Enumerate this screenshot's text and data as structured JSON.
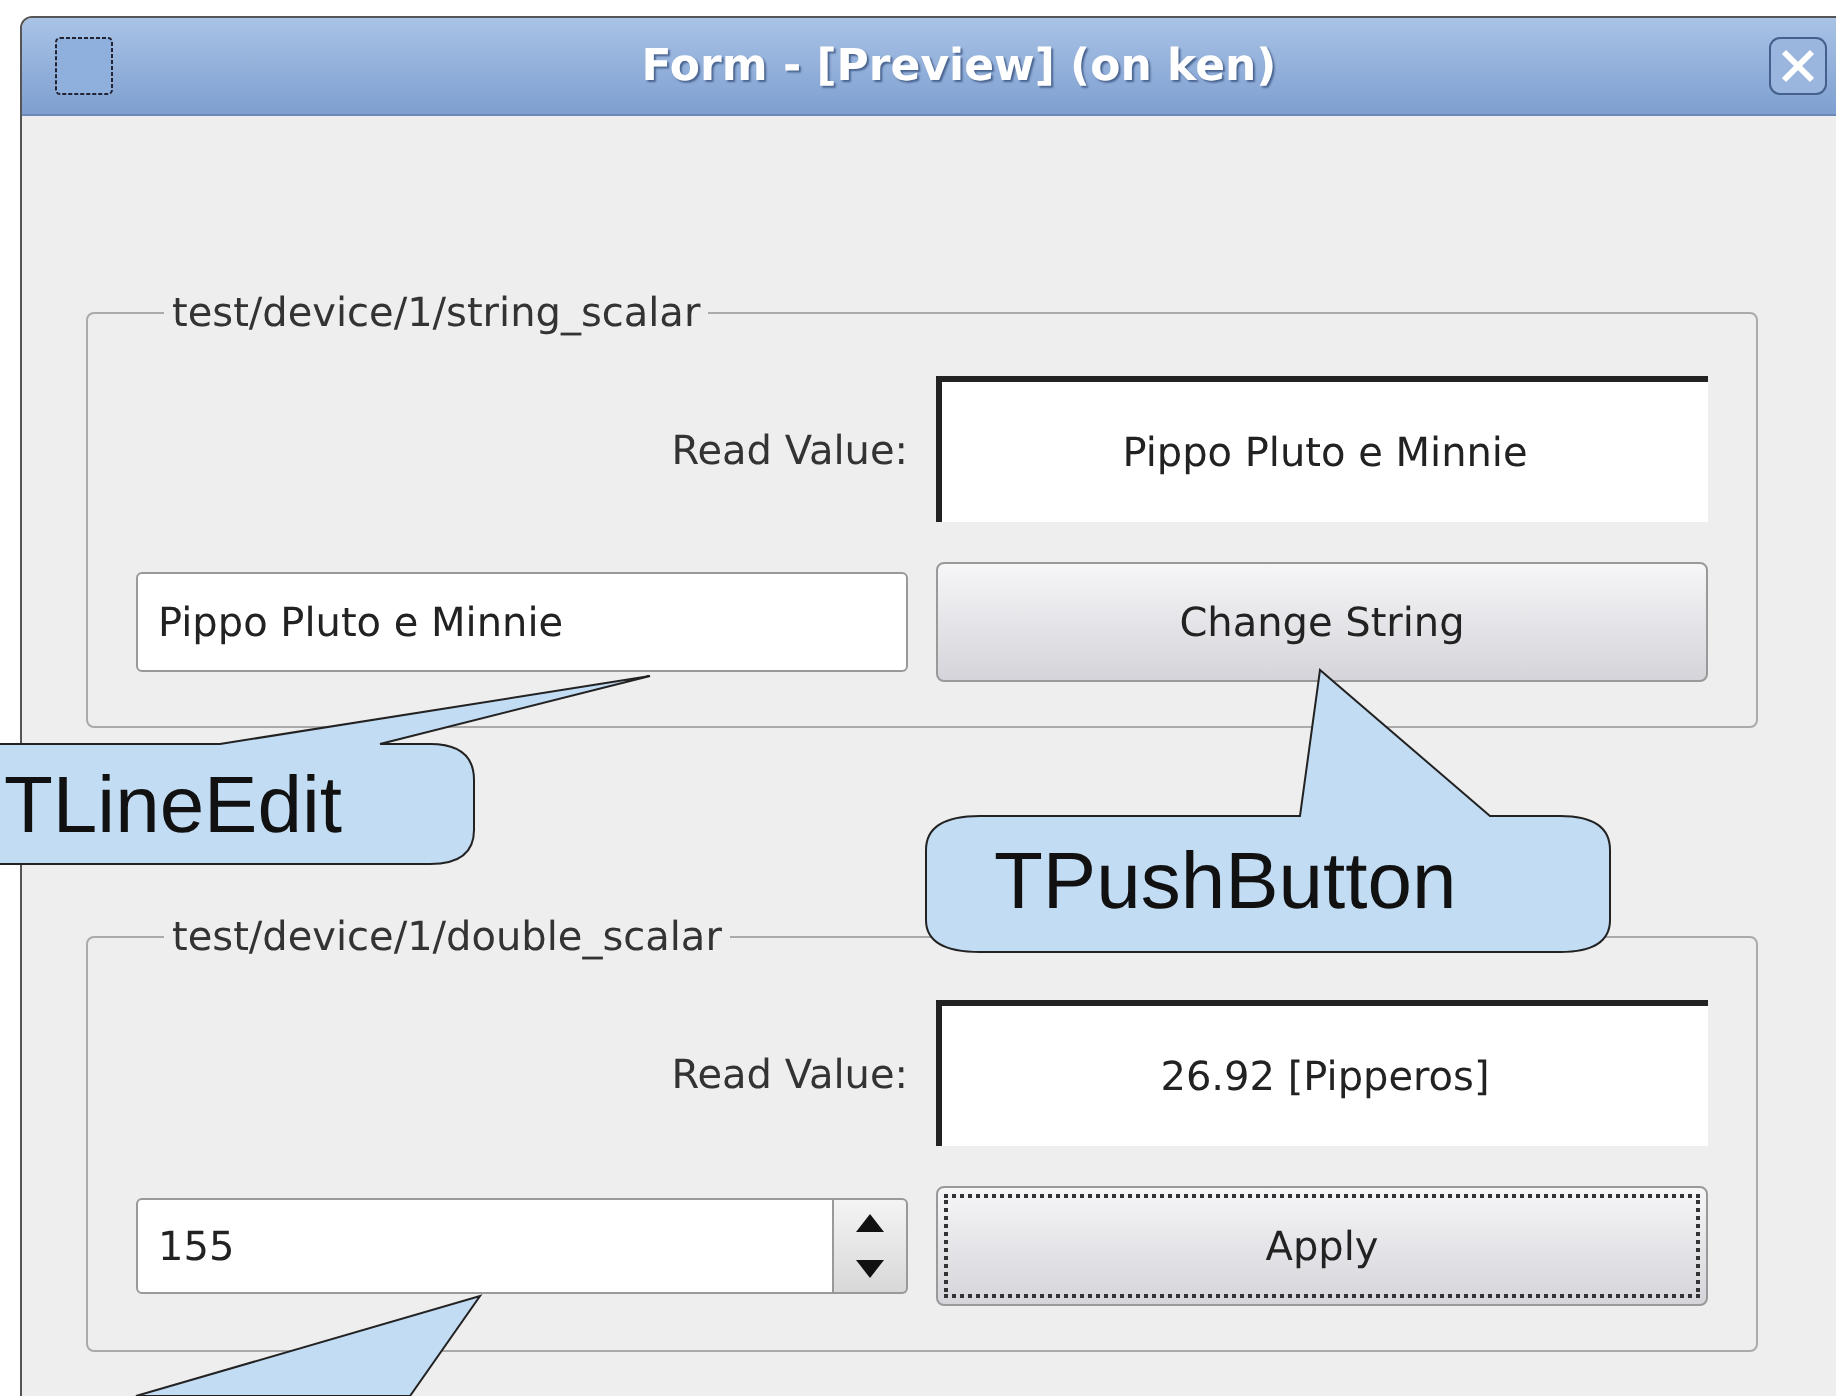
{
  "window": {
    "title": "Form - [Preview] (on ken)"
  },
  "groups": [
    {
      "title": "test/device/1/string_scalar",
      "read_label": "Read Value:",
      "read_value": "Pippo Pluto e Minnie",
      "input": {
        "kind": "line",
        "value": "Pippo Pluto e Minnie"
      },
      "button": {
        "label": "Change String",
        "focused": false
      }
    },
    {
      "title": "test/device/1/double_scalar",
      "read_label": "Read Value:",
      "read_value": "26.92 [Pipperos]",
      "input": {
        "kind": "spin",
        "value": "155"
      },
      "button": {
        "label": "Apply",
        "focused": true
      }
    }
  ],
  "callouts": [
    {
      "text": "TLineEdit"
    },
    {
      "text": "TPushButton"
    }
  ]
}
